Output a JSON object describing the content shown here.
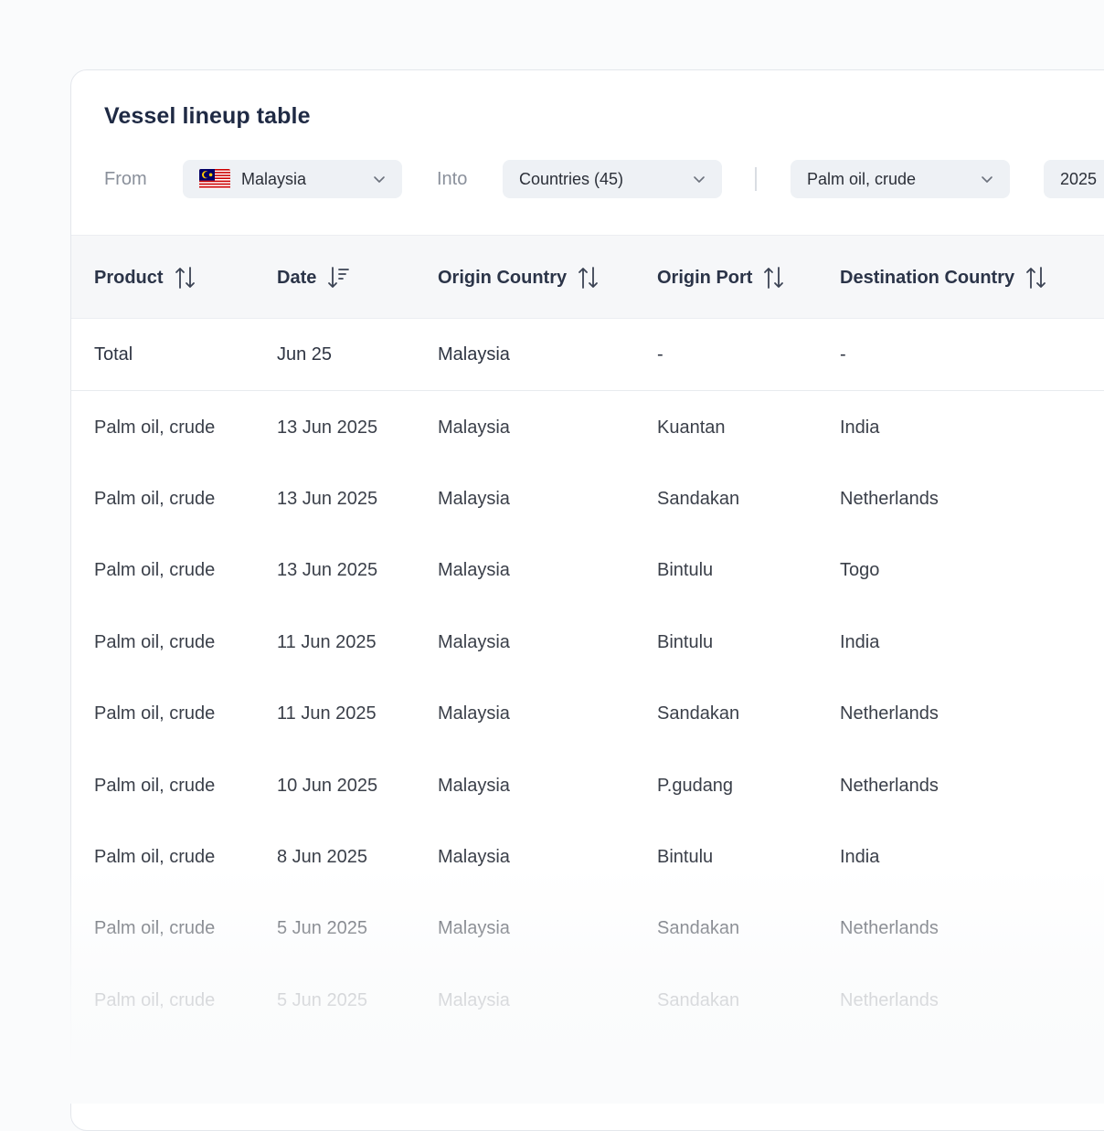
{
  "title": "Vessel lineup table",
  "filters": {
    "from_label": "From",
    "from_value": "Malaysia",
    "into_label": "Into",
    "into_value": "Countries (45)",
    "product_value": "Palm oil, crude",
    "year_value": "2025"
  },
  "columns": [
    {
      "label": "Product",
      "sort": "both"
    },
    {
      "label": "Date",
      "sort": "desc"
    },
    {
      "label": "Origin Country",
      "sort": "both"
    },
    {
      "label": "Origin Port",
      "sort": "both"
    },
    {
      "label": "Destination Country",
      "sort": "both"
    }
  ],
  "total": {
    "product": "Total",
    "date": "Jun 25",
    "origin_country": "Malaysia",
    "origin_port": "-",
    "destination_country": "-"
  },
  "rows": [
    {
      "product": "Palm oil, crude",
      "date": "13 Jun 2025",
      "origin_country": "Malaysia",
      "origin_port": "Kuantan",
      "destination_country": "India"
    },
    {
      "product": "Palm oil, crude",
      "date": "13 Jun 2025",
      "origin_country": "Malaysia",
      "origin_port": "Sandakan",
      "destination_country": "Netherlands"
    },
    {
      "product": "Palm oil, crude",
      "date": "13 Jun 2025",
      "origin_country": "Malaysia",
      "origin_port": "Bintulu",
      "destination_country": "Togo"
    },
    {
      "product": "Palm oil, crude",
      "date": "11 Jun 2025",
      "origin_country": "Malaysia",
      "origin_port": "Bintulu",
      "destination_country": "India"
    },
    {
      "product": "Palm oil, crude",
      "date": "11 Jun 2025",
      "origin_country": "Malaysia",
      "origin_port": "Sandakan",
      "destination_country": "Netherlands"
    },
    {
      "product": "Palm oil, crude",
      "date": "10 Jun 2025",
      "origin_country": "Malaysia",
      "origin_port": "P.gudang",
      "destination_country": "Netherlands"
    },
    {
      "product": "Palm oil, crude",
      "date": "8 Jun 2025",
      "origin_country": "Malaysia",
      "origin_port": "Bintulu",
      "destination_country": "India"
    },
    {
      "product": "Palm oil, crude",
      "date": "5 Jun 2025",
      "origin_country": "Malaysia",
      "origin_port": "Sandakan",
      "destination_country": "Netherlands"
    },
    {
      "product": "Palm oil, crude",
      "date": "5 Jun 2025",
      "origin_country": "Malaysia",
      "origin_port": "Sandakan",
      "destination_country": "Netherlands"
    }
  ],
  "colors": {
    "accent_text": "#1f2a44",
    "select_bg": "#eef1f5",
    "header_bg": "#f6f7f9"
  },
  "icons": {
    "sort_both": "sort-both-icon",
    "sort_desc": "sort-desc-icon",
    "chevron": "chevron-down-icon",
    "flag": "malaysia-flag-icon"
  }
}
